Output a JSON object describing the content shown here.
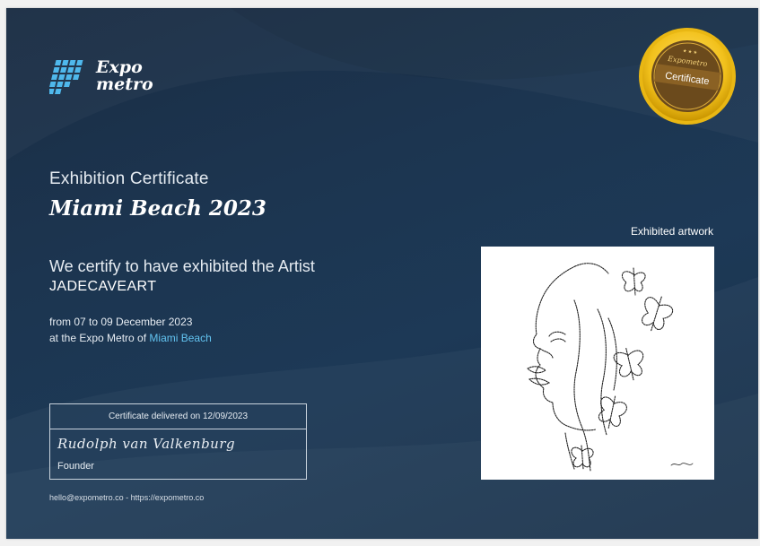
{
  "brand": {
    "name_line1": "Expo",
    "name_line2": "metro",
    "icon": "dot-grid-logo-icon",
    "accent": "#4fb8ec"
  },
  "seal": {
    "top_text": "Expometro",
    "label": "Certificate",
    "icon": "gold-seal-icon"
  },
  "certificate": {
    "subtitle": "Exhibition Certificate",
    "event": "Miami Beach 2023",
    "certify_text": "We certify to have exhibited the Artist",
    "artist": "JADECAVEART",
    "dates": "from 07 to 09 December 2023",
    "venue_prefix": "at the Expo Metro of",
    "venue_city": "Miami Beach"
  },
  "delivery": {
    "delivered_text": "Certificate delivered on 12/09/2023",
    "signature": "Rudolph van Valkenburg",
    "role": "Founder"
  },
  "footer": {
    "contact": "hello@expometro.co - https://expometro.co"
  },
  "artwork": {
    "label": "Exhibited artwork",
    "description_icon": "line-art-face-butterflies-image"
  },
  "colors": {
    "background": "#1c3550",
    "link": "#62c3f0",
    "gold": "#f2c11c"
  }
}
